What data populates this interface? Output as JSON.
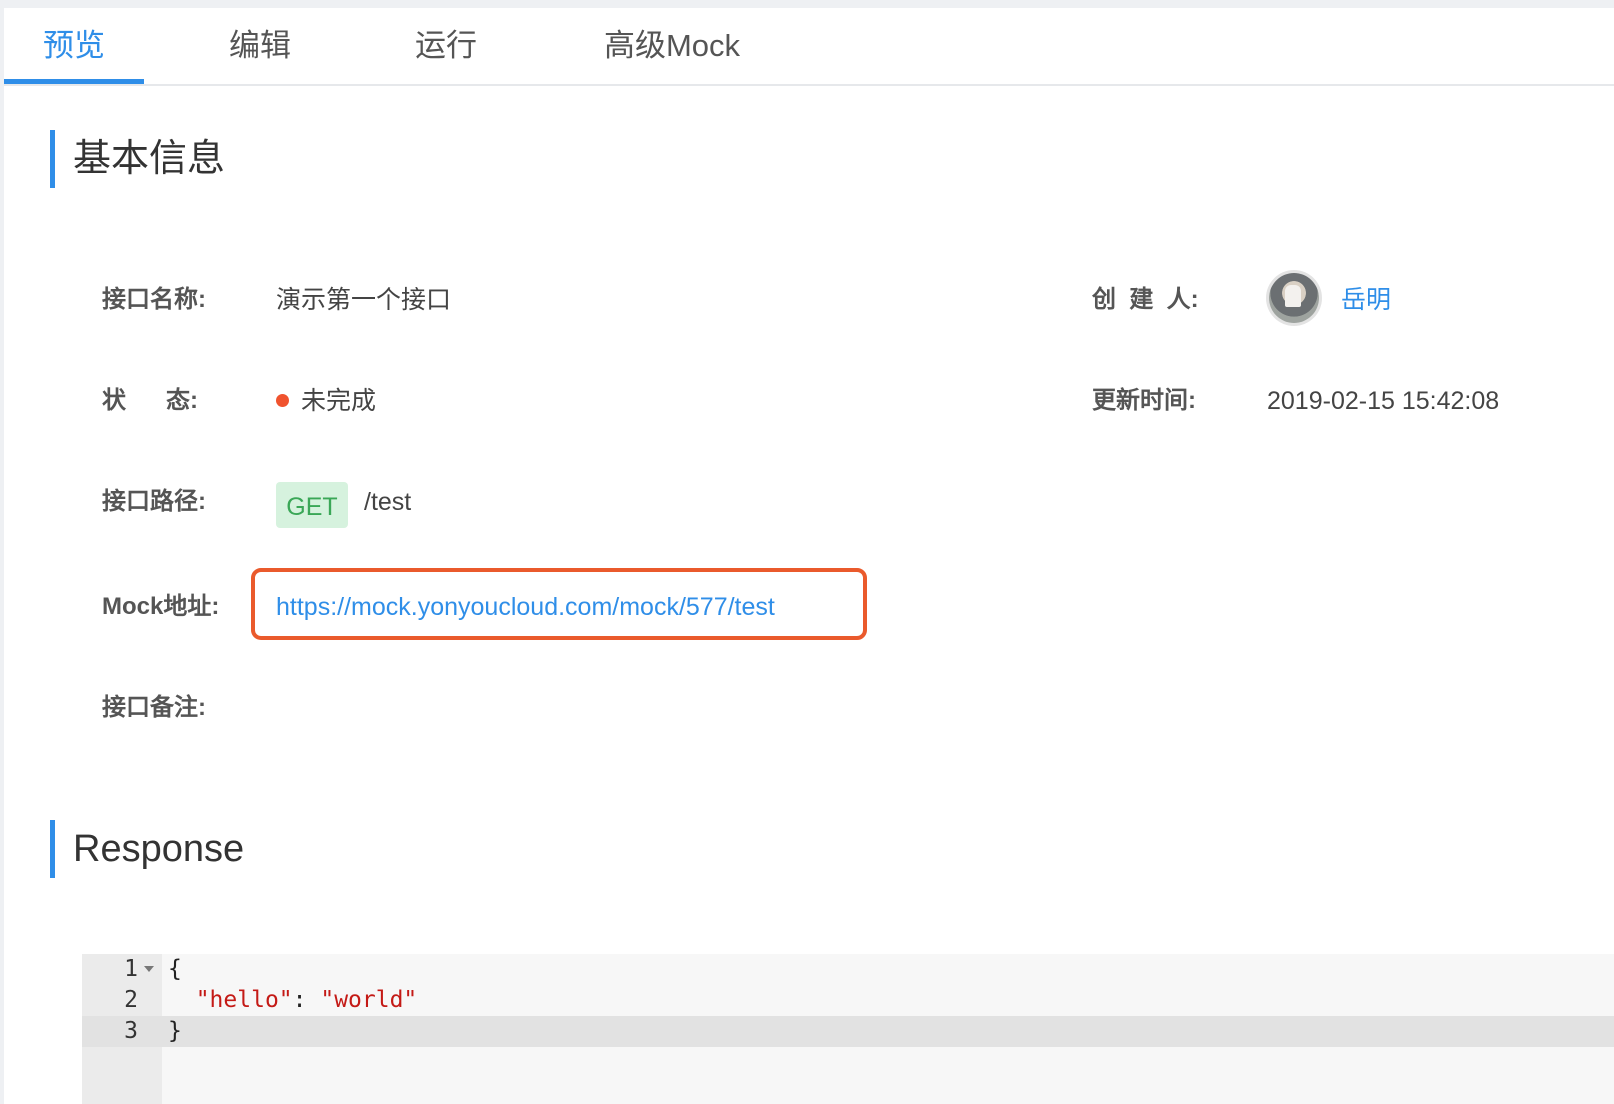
{
  "tabs": [
    {
      "label": "预览",
      "active": true
    },
    {
      "label": "编辑",
      "active": false
    },
    {
      "label": "运行",
      "active": false
    },
    {
      "label": "高级Mock",
      "active": false
    }
  ],
  "basic_info": {
    "title": "基本信息",
    "name_label": "接口名称:",
    "name_value": "演示第一个接口",
    "status_label": "状      态:",
    "status_value": "未完成",
    "path_label": "接口路径:",
    "method": "GET",
    "path_value": "/test",
    "mock_label": "Mock地址:",
    "mock_url": "https://mock.yonyoucloud.com/mock/577/test",
    "note_label": "接口备注:",
    "creator_label": "创  建  人:",
    "creator_name": "岳明",
    "updated_label": "更新时间:",
    "updated_value": "2019-02-15 15:42:08"
  },
  "response": {
    "title": "Response",
    "lines": [
      {
        "no": "1",
        "text": "{"
      },
      {
        "no": "2",
        "key": "\"hello\"",
        "sep": ": ",
        "val": "\"world\""
      },
      {
        "no": "3",
        "text": "}"
      }
    ]
  },
  "colors": {
    "accent": "#2f8ee8",
    "status": "#f0532e",
    "method_bg": "#d6f2de",
    "method_fg": "#3aa757",
    "highlight_border": "#ea5a2c"
  }
}
